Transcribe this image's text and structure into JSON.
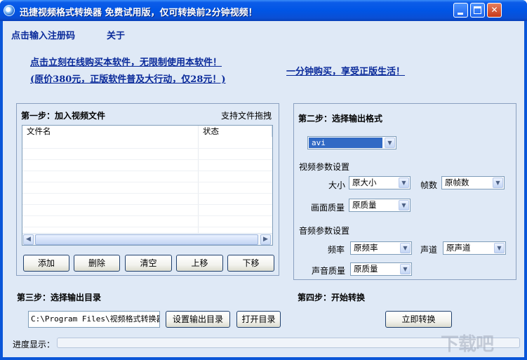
{
  "window": {
    "title": "迅捷视频格式转换器    免费试用版，仅可转换前2分钟视频！"
  },
  "links": {
    "register": "点击输入注册码",
    "about": "关于",
    "promo_line1": "点击立刻在线购买本软件，无限制使用本软件！",
    "promo_line2": "(原价380元，正版软件普及大行动，仅28元！)",
    "slogan": "一分钟购买，享受正版生活！"
  },
  "step1": {
    "title": "第一步：加入视频文件",
    "hint": "支持文件拖拽",
    "columns": [
      "文件名",
      "状态"
    ],
    "rows": [],
    "buttons": {
      "add": "添加",
      "delete": "删除",
      "clear": "清空",
      "up": "上移",
      "down": "下移"
    }
  },
  "step2": {
    "title": "第二步：选择输出格式",
    "format": "avi",
    "video_section": "视频参数设置",
    "size_label": "大小",
    "size_value": "原大小",
    "fps_label": "帧数",
    "fps_value": "原帧数",
    "quality_label": "画面质量",
    "quality_value": "原质量",
    "audio_section": "音频参数设置",
    "samplerate_label": "频率",
    "samplerate_value": "原频率",
    "channel_label": "声道",
    "channel_value": "原声道",
    "audio_quality_label": "声音质量",
    "audio_quality_value": "原质量"
  },
  "step3": {
    "title": "第三步：选择输出目录",
    "path": "C:\\Program Files\\视频格式转换器",
    "set_button": "设置输出目录",
    "open_button": "打开目录"
  },
  "step4": {
    "title": "第四步：开始转换",
    "start_button": "立即转换"
  },
  "progress": {
    "label": "进度显示：",
    "value": 0
  },
  "watermark": "下载吧",
  "icons": {
    "scroll_left": "◀",
    "scroll_right": "▶",
    "dropdown": "▼",
    "close": "✕"
  }
}
